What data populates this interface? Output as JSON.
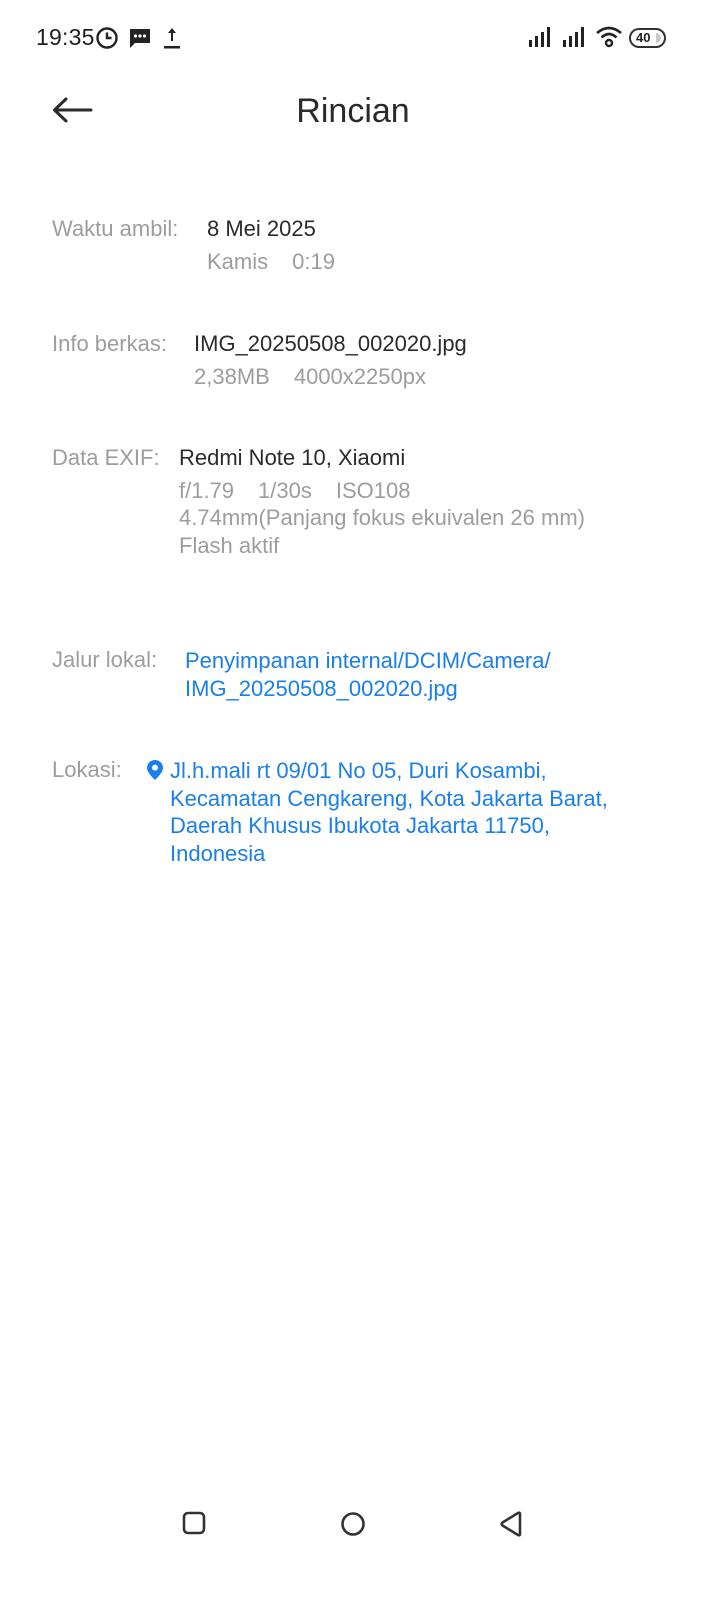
{
  "status_bar": {
    "time": "19:35",
    "battery": "40",
    "icons": [
      "clock-icon",
      "message-icon",
      "upload-icon",
      "signal-icon",
      "signal-icon",
      "wifi-icon",
      "battery-icon"
    ]
  },
  "header": {
    "title": "Rincian",
    "back_icon": "arrow-left-icon"
  },
  "details": {
    "time": {
      "label": "Waktu ambil:",
      "date": "8 Mei 2025",
      "day": "Kamis",
      "clock": "0:19"
    },
    "file": {
      "label": "Info berkas:",
      "name": "IMG_20250508_002020.jpg",
      "size": "2,38MB",
      "resolution": "4000x2250px"
    },
    "exif": {
      "label": "Data EXIF:",
      "device": "Redmi Note 10, Xiaomi",
      "aperture": "f/1.79",
      "shutter": "1/30s",
      "iso": "ISO108",
      "focal": "4.74mm(Panjang fokus ekuivalen 26 mm)",
      "flash": "Flash aktif"
    },
    "path": {
      "label": "Jalur lokal:",
      "line1": "Penyimpanan internal/DCIM/Camera/",
      "line2": "IMG_20250508_002020.jpg"
    },
    "location": {
      "label": "Lokasi:",
      "icon": "location-pin-icon",
      "line1": "Jl.h.mali rt 09/01 No 05, Duri Kosambi,",
      "line2": "Kecamatan Cengkareng, Kota Jakarta Barat,",
      "line3": "Daerah Khusus Ibukota Jakarta 11750,",
      "line4": "Indonesia"
    }
  },
  "nav_bar": {
    "buttons": [
      "recents-icon",
      "home-icon",
      "back-icon"
    ]
  },
  "colors": {
    "link": "#1a7fe8",
    "label": "#9d9d9d",
    "text": "#2b2b2b",
    "background": "#ffffff"
  }
}
